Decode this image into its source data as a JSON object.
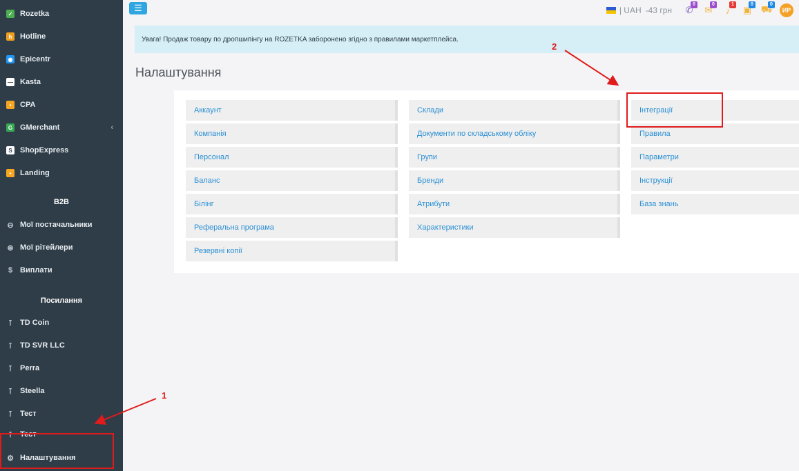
{
  "sidebar": {
    "apps": [
      {
        "label": "Rozetka",
        "icon": "rozetka-icon",
        "color": "#4caf50",
        "glyph": "✓"
      },
      {
        "label": "Hotline",
        "icon": "hotline-icon",
        "color": "#f0a01e",
        "glyph": "h"
      },
      {
        "label": "Epicentr",
        "icon": "epicentr-icon",
        "color": "#2196f3",
        "glyph": "◉"
      },
      {
        "label": "Kasta",
        "icon": "kasta-icon",
        "color": "#ffffff",
        "glyph": "—"
      },
      {
        "label": "CPA",
        "icon": "cpa-icon",
        "color": "#f5a623",
        "glyph": "•"
      },
      {
        "label": "GMerchant",
        "icon": "gmerchant-icon",
        "color": "#34a853",
        "glyph": "G"
      },
      {
        "label": "ShopExpress",
        "icon": "shopexpress-icon",
        "color": "#ffffff",
        "glyph": "S"
      },
      {
        "label": "Landing",
        "icon": "landing-icon",
        "color": "#f5a623",
        "glyph": "•"
      }
    ],
    "b2b_title": "B2B",
    "b2b_items": [
      {
        "label": "Мої постачальники",
        "glyph": "⊖"
      },
      {
        "label": "Мої рітейлери",
        "glyph": "⊛"
      },
      {
        "label": "Виплати",
        "glyph": "$"
      }
    ],
    "links_title": "Посилання",
    "link_items": [
      {
        "label": "TD Coin",
        "glyph": "⊺"
      },
      {
        "label": "TD SVR LLC",
        "glyph": "⊺"
      },
      {
        "label": "Perra",
        "glyph": "⊺"
      },
      {
        "label": "Steella",
        "glyph": "⊺"
      },
      {
        "label": "Тест",
        "glyph": "⊺"
      },
      {
        "label": "Тест",
        "glyph": "⊺"
      }
    ],
    "settings_label": "Налаштування",
    "gmerchant_caret": "‹"
  },
  "topbar": {
    "menu_icon": "☰",
    "currency": "| UAH",
    "balance": "-43 грн",
    "icons": [
      {
        "name": "phone-icon",
        "glyph": "✆",
        "badge": "0",
        "badge_color": "#9c4dcc"
      },
      {
        "name": "chat-icon",
        "glyph": "✉",
        "badge": "0",
        "badge_color": "#9c4dcc"
      },
      {
        "name": "bell-icon",
        "glyph": "♪",
        "badge": "1",
        "badge_color": "#e53935"
      },
      {
        "name": "box-icon",
        "glyph": "▣",
        "badge": "0",
        "badge_color": "#1e88e5"
      },
      {
        "name": "cart-icon",
        "glyph": "⛟",
        "badge": "0",
        "badge_color": "#1e88e5"
      }
    ],
    "avatar": "ИР"
  },
  "alert": {
    "text": "Увага! Продаж товару по дропшипінгу на ROZETKA заборонено згідно з правилами маркетплейса."
  },
  "page_title": "Налаштування",
  "columns": [
    [
      "Аккаунт",
      "Компанія",
      "Персонал",
      "Баланс",
      "Білінг",
      "Реферальна програма",
      "Резервні копії"
    ],
    [
      "Склади",
      "Документи по складському обліку",
      "Групи",
      "Бренди",
      "Атрибути",
      "Характеристики"
    ],
    [
      "Інтеграції",
      "Правила",
      "Параметри",
      "Інструкції",
      "База знань"
    ]
  ],
  "annotations": {
    "label_1": "1",
    "label_2": "2"
  },
  "colors": {
    "sidebar_bg": "#2f3d48",
    "accent": "#2fa6e0",
    "link": "#2a8fd4",
    "annotation": "#e01b1b"
  }
}
